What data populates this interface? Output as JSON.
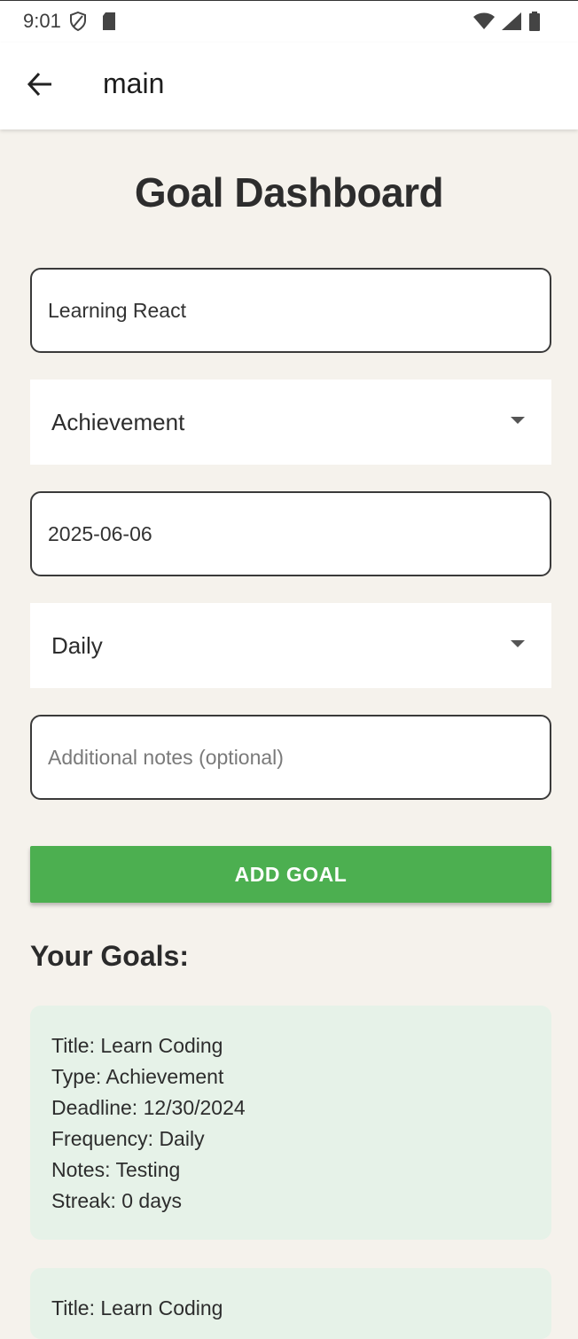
{
  "status_bar": {
    "time": "9:01",
    "icons": [
      "shield-icon",
      "sd-card-icon",
      "wifi-icon",
      "signal-icon",
      "battery-icon"
    ]
  },
  "app_bar": {
    "back_icon": "arrow-left-icon",
    "title": "main"
  },
  "page": {
    "title": "Goal Dashboard"
  },
  "form": {
    "title_field": {
      "value": "Learning React"
    },
    "type_select": {
      "value": "Achievement"
    },
    "deadline_field": {
      "value": "2025-06-06"
    },
    "frequency_select": {
      "value": "Daily"
    },
    "notes_field": {
      "placeholder": "Additional notes (optional)"
    },
    "add_button": "ADD GOAL"
  },
  "goals": {
    "heading": "Your Goals:",
    "items": [
      {
        "title": "Title: Learn Coding",
        "type": "Type: Achievement",
        "deadline": "Deadline: 12/30/2024",
        "frequency": "Frequency: Daily",
        "notes": "Notes: Testing",
        "streak": "Streak: 0 days"
      },
      {
        "title": "Title: Learn Coding"
      }
    ]
  },
  "colors": {
    "accent": "#4caf50",
    "background": "#f5f2ec",
    "card": "#e6f2e8"
  }
}
